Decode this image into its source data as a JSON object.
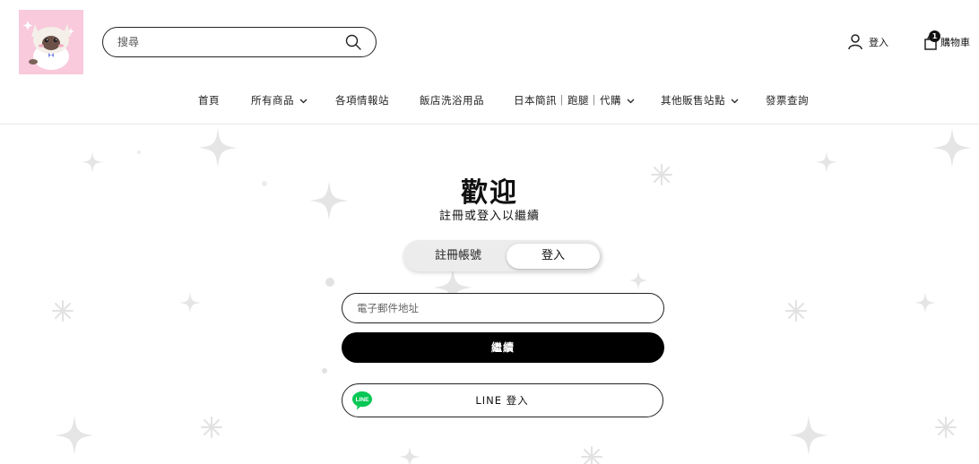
{
  "header": {
    "search": {
      "placeholder": "搜尋"
    },
    "account": {
      "label": "登入"
    },
    "cart": {
      "label": "購物車",
      "count": "1"
    }
  },
  "nav": {
    "items": [
      {
        "label": "首頁"
      },
      {
        "label": "所有商品"
      },
      {
        "label": "各項情報站"
      },
      {
        "label": "飯店洗浴用品"
      },
      {
        "label": "日本簡訊｜跑腿｜代購"
      },
      {
        "label": "其他販售站點"
      },
      {
        "label": "發票查詢"
      }
    ]
  },
  "login": {
    "title": "歡迎",
    "subtitle": "註冊或登入以繼續",
    "tabs": {
      "register": "註冊帳號",
      "login": "登入"
    },
    "email_placeholder": "電子郵件地址",
    "continue_label": "繼續",
    "line_label": "LINE 登入",
    "line_logo_text": "LINE"
  },
  "colors": {
    "accent": "#000000",
    "line_green": "#06C755",
    "logo_bg": "#F9C9DC"
  }
}
